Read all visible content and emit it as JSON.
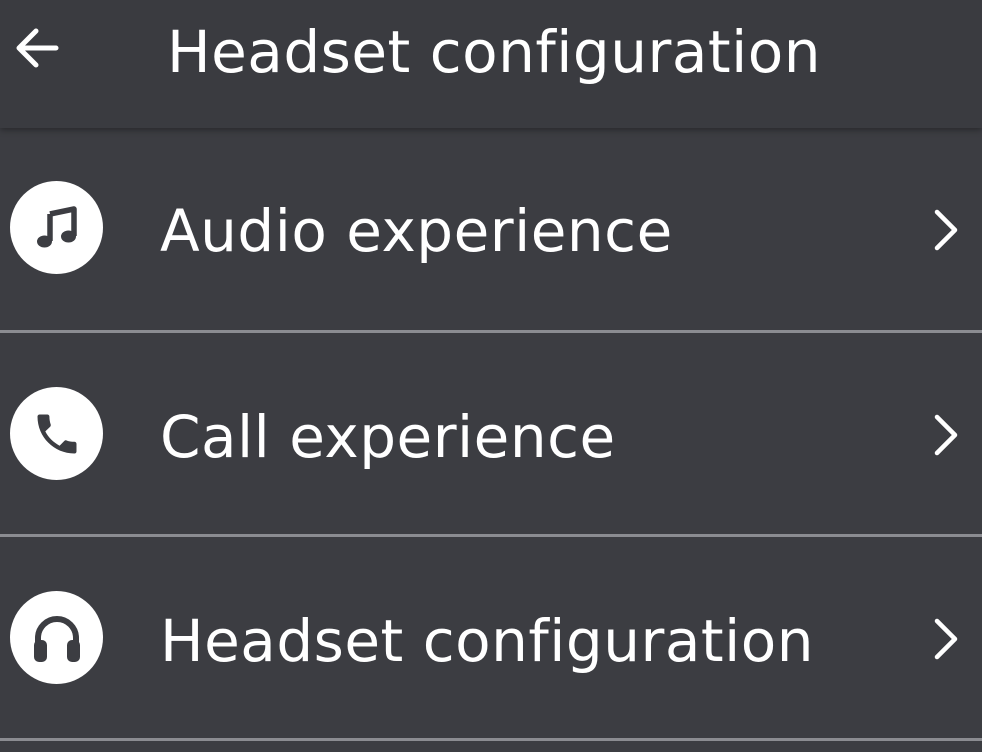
{
  "header": {
    "back_icon": "arrow-left-icon",
    "title": "Headset configuration"
  },
  "menu": {
    "items": [
      {
        "label": "Audio experience",
        "icon": "music-note-icon"
      },
      {
        "label": "Call experience",
        "icon": "phone-icon"
      },
      {
        "label": "Headset configuration",
        "icon": "headphones-icon"
      }
    ],
    "chevron_icon": "chevron-right-icon"
  },
  "colors": {
    "background": "#3c3d42",
    "text": "#ffffff",
    "divider": "#8b8c91",
    "icon_glyph": "#3c3d42"
  }
}
